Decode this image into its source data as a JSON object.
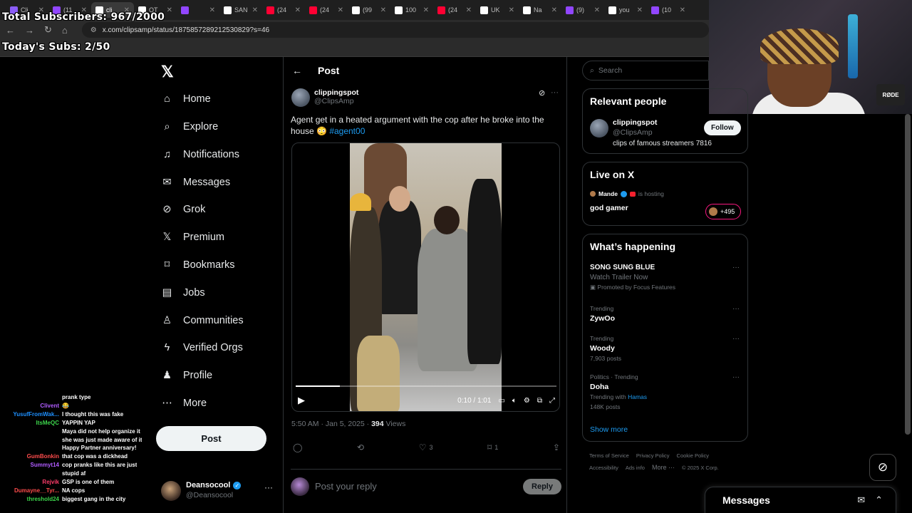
{
  "stream_overlay": {
    "total_subscribers": "Total Subscribers: 967/2000",
    "todays_subs": "Today's Subs: 2/50"
  },
  "browser": {
    "tabs": [
      {
        "label": "Cli",
        "color": "#8a5cf6",
        "active": false
      },
      {
        "label": "(11",
        "color": "#9146ff",
        "active": false
      },
      {
        "label": "cli",
        "color": "#ffffff",
        "active": true
      },
      {
        "label": "QT",
        "color": "#ffffff",
        "active": false
      },
      {
        "label": "",
        "color": "#9146ff",
        "active": false
      },
      {
        "label": "SAN",
        "color": "#ffffff",
        "active": false
      },
      {
        "label": "(24",
        "color": "#ff0033",
        "active": false
      },
      {
        "label": "(24",
        "color": "#ff0033",
        "active": false
      },
      {
        "label": "(99",
        "color": "#ffffff",
        "active": false
      },
      {
        "label": "100",
        "color": "#ffffff",
        "active": false
      },
      {
        "label": "(24",
        "color": "#ff0033",
        "active": false
      },
      {
        "label": "UK",
        "color": "#ffffff",
        "active": false
      },
      {
        "label": "Na",
        "color": "#ffffff",
        "active": false
      },
      {
        "label": "(9)",
        "color": "#9146ff",
        "active": false
      },
      {
        "label": "you",
        "color": "#ffffff",
        "active": false
      },
      {
        "label": "(10",
        "color": "#9146ff",
        "active": false
      }
    ],
    "url": "x.com/clipsamp/status/1875857289212530829?s=46"
  },
  "chat": [
    {
      "user": "",
      "msg": "prank type",
      "color": "#a970ff"
    },
    {
      "user": "Clivent",
      "msg": "😂",
      "color": "#b05cff"
    },
    {
      "user": "YusufFromWak...",
      "msg": "I thought this was fake",
      "color": "#1e90ff"
    },
    {
      "user": "ItsMeQC",
      "msg": "YAPPIN YAP",
      "color": "#3cd44b"
    },
    {
      "user": "",
      "msg": "Maya did not help organize it",
      "color": "#2e6bff"
    },
    {
      "user": "",
      "msg": "she was just made aware of it",
      "color": "#2e6bff"
    },
    {
      "user": "",
      "msg": "Happy Partner anniversary!",
      "color": "#8a8aff"
    },
    {
      "user": "GumBonkin",
      "msg": "that cop was a dickhead",
      "color": "#ff4c4c"
    },
    {
      "user": "Summyt14",
      "msg": "cop pranks like this are just",
      "color": "#b05cff"
    },
    {
      "user": "",
      "msg": "stupid af",
      "color": "#b05cff"
    },
    {
      "user": "Rejvik",
      "msg": "GSP is one of them",
      "color": "#ff3c6a"
    },
    {
      "user": "Dumayne__Tyr...",
      "msg": "NA cops",
      "color": "#ff4c4c"
    },
    {
      "user": "threshold24",
      "msg": "biggest gang in the city",
      "color": "#3cd44b"
    }
  ],
  "nav": {
    "items": [
      {
        "label": "Home",
        "icon": "home-icon",
        "glyph": "⌂"
      },
      {
        "label": "Explore",
        "icon": "search-icon",
        "glyph": "⌕"
      },
      {
        "label": "Notifications",
        "icon": "bell-icon",
        "glyph": "♫"
      },
      {
        "label": "Messages",
        "icon": "envelope-icon",
        "glyph": "✉"
      },
      {
        "label": "Grok",
        "icon": "grok-icon",
        "glyph": "⊘"
      },
      {
        "label": "Premium",
        "icon": "x-logo-icon",
        "glyph": "𝕏"
      },
      {
        "label": "Bookmarks",
        "icon": "bookmark-icon",
        "glyph": "⌑"
      },
      {
        "label": "Jobs",
        "icon": "briefcase-icon",
        "glyph": "▤"
      },
      {
        "label": "Communities",
        "icon": "people-icon",
        "glyph": "♙"
      },
      {
        "label": "Verified Orgs",
        "icon": "lightning-icon",
        "glyph": "ϟ"
      },
      {
        "label": "Profile",
        "icon": "person-icon",
        "glyph": "♟"
      },
      {
        "label": "More",
        "icon": "more-circle-icon",
        "glyph": "⋯"
      }
    ],
    "post_button": "Post",
    "account": {
      "name": "Deansocool",
      "handle": "@Deansocool"
    }
  },
  "post": {
    "header": "Post",
    "author_name": "clippingspot",
    "author_handle": "@ClipsAmp",
    "text": "Agent get in a heated argument with the cop after he broke into the house 😳 ",
    "hashtag": "#agent00",
    "video_time": "0:10 / 1:01",
    "video_progress": 0.17,
    "timestamp": "5:50 AM · Jan 5, 2025 · ",
    "views_count": "394",
    "views_label": " Views",
    "likes": "3",
    "bookmarks": "1",
    "reply_placeholder": "Post your reply",
    "reply_button": "Reply"
  },
  "sidebar": {
    "search_placeholder": "Search",
    "relevant_people": {
      "title": "Relevant people",
      "name": "clippingspot",
      "handle": "@ClipsAmp",
      "bio": "clips of famous streamers 7816",
      "follow": "Follow"
    },
    "live": {
      "title": "Live on X",
      "host": "Mande",
      "hosting": "is hosting",
      "space": "god gamer",
      "listeners": "+495"
    },
    "happening": {
      "title": "What’s happening",
      "promo_title": "SONG SUNG BLUE",
      "promo_sub": "Watch Trailer Now",
      "promo_by": "Promoted by Focus Features",
      "trends": [
        {
          "context": "Trending",
          "name": "ZywOo",
          "extra": ""
        },
        {
          "context": "Trending",
          "name": "Woody",
          "extra": "7,903 posts"
        },
        {
          "context": "Politics · Trending",
          "name": "Doha",
          "extra": "148K posts"
        }
      ],
      "doha_with": "Trending with ",
      "doha_with_tag": "Hamas",
      "show_more": "Show more"
    },
    "footer": [
      "Terms of Service",
      "Privacy Policy",
      "Cookie Policy",
      "Accessibility",
      "Ads info",
      "More ···",
      "© 2025 X Corp."
    ],
    "messages": "Messages"
  },
  "webcam_brand": "RØDE"
}
